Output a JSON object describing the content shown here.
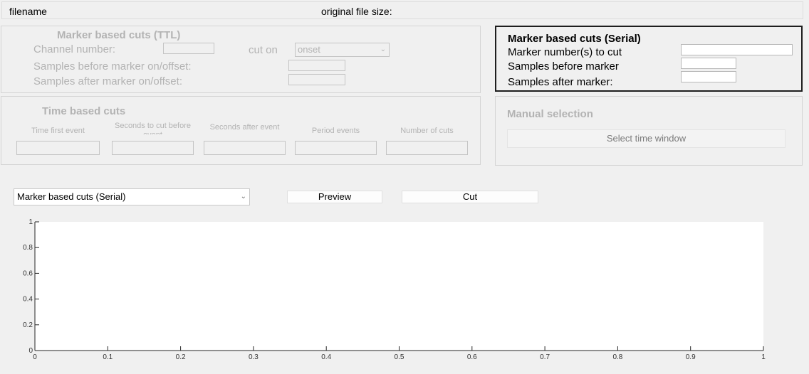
{
  "header": {
    "filename_label": "filename",
    "filesize_label": "original file size:"
  },
  "ttl_panel": {
    "title": "Marker based cuts (TTL)",
    "channel_label": "Channel number:",
    "cut_on_label": "cut on",
    "cut_on_value": "onset",
    "before_label": "Samples before marker on/offset:",
    "after_label": "Samples after marker on/offset:"
  },
  "serial_panel": {
    "title": "Marker based cuts (Serial)",
    "marker_numbers_label": "Marker number(s) to cut",
    "before_label": "Samples before marker",
    "after_label": "Samples after marker:"
  },
  "time_panel": {
    "title": "Time based cuts",
    "columns": [
      "Time first event",
      "Seconds to cut before event",
      "Seconds after event",
      "Period events",
      "Number of cuts"
    ]
  },
  "manual_panel": {
    "title": "Manual selection",
    "button_label": "Select time window"
  },
  "controls": {
    "mode_value": "Marker based cuts (Serial)",
    "preview_label": "Preview",
    "cut_label": "Cut"
  },
  "chart_data": {
    "type": "line",
    "title": "",
    "xlabel": "",
    "ylabel": "",
    "xlim": [
      0,
      1
    ],
    "ylim": [
      0,
      1
    ],
    "xticks": [
      "0",
      "0.1",
      "0.2",
      "0.3",
      "0.4",
      "0.5",
      "0.6",
      "0.7",
      "0.8",
      "0.9",
      "1"
    ],
    "yticks": [
      "0",
      "0.2",
      "0.4",
      "0.6",
      "0.8",
      "1"
    ],
    "series": [],
    "grid": false
  }
}
